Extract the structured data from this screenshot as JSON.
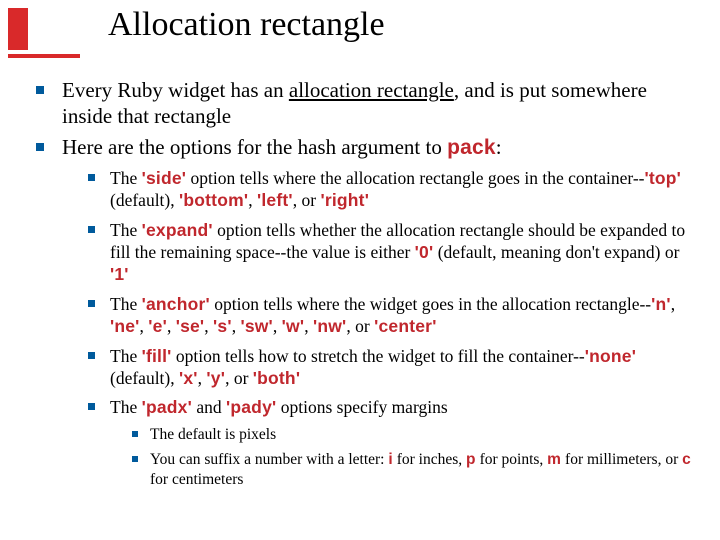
{
  "title": "Allocation rectangle",
  "bullets": {
    "b1_pre": "Every Ruby widget has an ",
    "b1_u": "allocation rectangle",
    "b1_post": ", and is put somewhere inside that rectangle",
    "b2_pre": "Here are the options for the hash argument to ",
    "b2_code": "pack",
    "b2_post": ":",
    "side": {
      "t1": "The ",
      "c_side": "'side'",
      "t2": " option tells where the allocation rectangle goes in the container--",
      "c_top": "'top'",
      "t3": " (default), ",
      "c_bottom": "'bottom'",
      "t4": ", ",
      "c_left": "'left'",
      "t5": ", or ",
      "c_right": "'right'"
    },
    "expand": {
      "t1": "The ",
      "c_expand": "'expand'",
      "t2": " option tells whether the allocation rectangle should be expanded to fill the remaining space--the value is either ",
      "c_0": "'0'",
      "t3": " (default, meaning don't expand) or ",
      "c_1": "'1'"
    },
    "anchor": {
      "t1": "The ",
      "c_anchor": "'anchor'",
      "t2": " option tells where the widget goes in the allocation rectangle--",
      "c_n": "'n'",
      "s2": ", ",
      "c_ne": "'ne'",
      "s3": ", ",
      "c_e": "'e'",
      "s4": ", ",
      "c_se": "'se'",
      "s5": ", ",
      "c_s": "'s'",
      "s6": ", ",
      "c_sw": "'sw'",
      "s7": ", ",
      "c_w": "'w'",
      "s8": ", ",
      "c_nw": "'nw'",
      "s9": ", or ",
      "c_center": "'center'"
    },
    "fill": {
      "t1": "The ",
      "c_fill": "'fill'",
      "t2": " option tells how to stretch the widget to fill the container--",
      "c_none": "'none'",
      "t3": " (default), ",
      "c_x": "'x'",
      "s1": ", ",
      "c_y": "'y'",
      "s2": ", or ",
      "c_both": "'both'"
    },
    "pad": {
      "t1": "The ",
      "c_padx": "'padx'",
      "t2": " and ",
      "c_pady": "'pady'",
      "t3": " options specify margins"
    },
    "units": {
      "u1": "The default is pixels",
      "t1": "You can suffix a number with a letter: ",
      "c_i": "i",
      "t2": " for inches, ",
      "c_p": "p",
      "t3": " for points, ",
      "c_m": "m",
      "t4": " for millimeters, or ",
      "c_c": "c",
      "t5": " for centimeters"
    }
  },
  "colors": {
    "accent_red": "#d9292a",
    "code_red": "#c0272d",
    "bullet_blue": "#005a9c"
  }
}
